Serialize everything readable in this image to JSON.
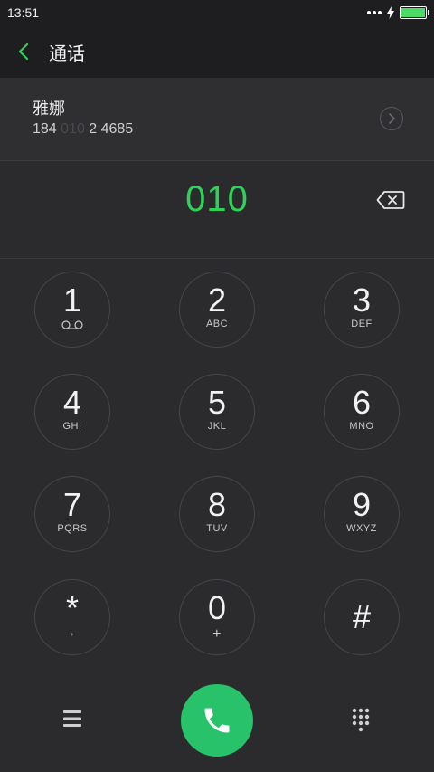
{
  "status": {
    "time": "13:51"
  },
  "header": {
    "title": "通话"
  },
  "contact": {
    "name": "雅娜",
    "number_prefix": "184 ",
    "number_match": "010",
    "number_suffix": " 2 4685"
  },
  "dialer": {
    "input": "010"
  },
  "keys": [
    {
      "digit": "1",
      "letters": ""
    },
    {
      "digit": "2",
      "letters": "ABC"
    },
    {
      "digit": "3",
      "letters": "DEF"
    },
    {
      "digit": "4",
      "letters": "GHI"
    },
    {
      "digit": "5",
      "letters": "JKL"
    },
    {
      "digit": "6",
      "letters": "MNO"
    },
    {
      "digit": "7",
      "letters": "PQRS"
    },
    {
      "digit": "8",
      "letters": "TUV"
    },
    {
      "digit": "9",
      "letters": "WXYZ"
    },
    {
      "digit": "*",
      "letters": ","
    },
    {
      "digit": "0",
      "letters": "+"
    },
    {
      "digit": "#",
      "letters": ""
    }
  ],
  "colors": {
    "accent": "#30d158",
    "call": "#27c26a",
    "background": "#2b2b2e"
  },
  "icons": [
    "back-arrow-icon",
    "detail-chevron-icon",
    "backspace-icon",
    "voicemail-icon",
    "menu-icon",
    "phone-icon",
    "dialpad-icon",
    "battery-icon",
    "charging-icon",
    "more-dots-icon"
  ]
}
